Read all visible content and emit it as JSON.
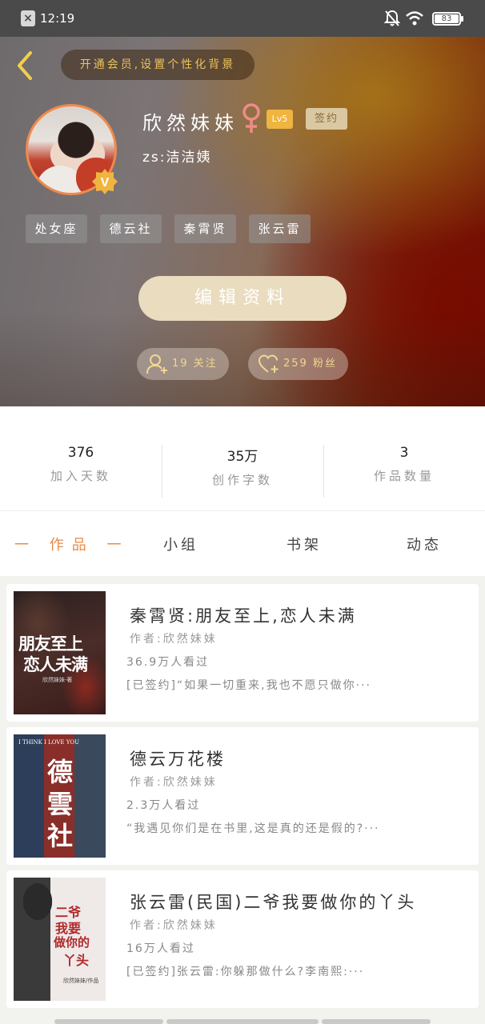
{
  "status_bar": {
    "time": "12:19",
    "battery": "83"
  },
  "header": {
    "vip_banner": "开通会员,设置个性化背景"
  },
  "profile": {
    "name": "欣然妹妹",
    "level": "Lv5",
    "signed": "签约",
    "subtitle": "zs:洁洁姨",
    "tags": [
      "处女座",
      "德云社",
      "秦霄贤",
      "张云雷"
    ],
    "edit_button": "编辑资料",
    "following": "19 关注",
    "followers": "259 粉丝"
  },
  "stats": [
    {
      "value": "376",
      "label": "加入天数"
    },
    {
      "value": "35万",
      "label": "创作字数"
    },
    {
      "value": "3",
      "label": "作品数量"
    }
  ],
  "tabs": [
    "一 作品 一",
    "小组",
    "书架",
    "动态"
  ],
  "books": [
    {
      "title": "秦霄贤:朋友至上,恋人未满",
      "author": "作者:欣然妹妹",
      "views": "36.9万人看过",
      "desc": "[已签约]“如果一切重来,我也不愿只做你···",
      "cover_text": [
        "朋友至上",
        "恋人未满"
      ],
      "cover_sub": "欣然妹妹·著"
    },
    {
      "title": "德云万花楼",
      "author": "作者:欣然妹妹",
      "views": "2.3万人看过",
      "desc": "“我遇见你们是在书里,这是真的还是假的?···",
      "cover_text": [
        "德",
        "雲",
        "社"
      ],
      "cover_sub": "I THINK I LOVE YOU"
    },
    {
      "title": "张云雷(民国)二爷我要做你的丫头",
      "author": "作者:欣然妹妹",
      "views": "16万人看过",
      "desc": "[已签约]张云雷:你躲那做什么?李南熙:···",
      "cover_text": [
        "二爷",
        "我要",
        "做你的",
        "丫头"
      ],
      "cover_sub": "欣然妹妹/作品"
    }
  ]
}
